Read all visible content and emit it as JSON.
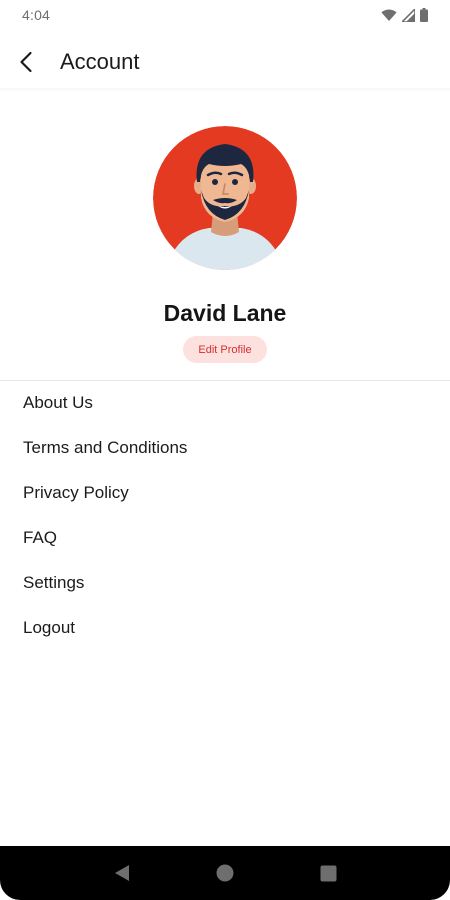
{
  "status_bar": {
    "time": "4:04",
    "icons": [
      "wifi-icon",
      "cell-signal-icon",
      "battery-icon"
    ]
  },
  "app_bar": {
    "back_icon": "chevron-left-icon",
    "title": "Account"
  },
  "profile": {
    "avatar": "user-avatar-illustration",
    "name": "David Lane",
    "edit_label": "Edit Profile"
  },
  "menu": {
    "items": [
      {
        "label": "About Us"
      },
      {
        "label": "Terms and Conditions"
      },
      {
        "label": "Privacy Policy"
      },
      {
        "label": "FAQ"
      },
      {
        "label": "Settings"
      },
      {
        "label": "Logout"
      }
    ]
  },
  "nav_bar": {
    "buttons": [
      "back-triangle-icon",
      "home-circle-icon",
      "recents-square-icon"
    ]
  },
  "colors": {
    "avatar_bg": "#e53a22",
    "edit_bg": "#fde1df",
    "edit_text": "#d32f2f",
    "nav_bg": "#000000"
  }
}
